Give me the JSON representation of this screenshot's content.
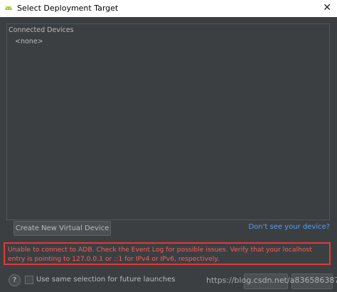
{
  "window": {
    "title": "Select Deployment Target",
    "close_glyph": "✕"
  },
  "devices": {
    "header": "Connected Devices",
    "empty_item": "<none>"
  },
  "actions": {
    "create_virtual_device": "Create New Virtual Device",
    "dont_see_device": "Don't see your device?"
  },
  "error": {
    "message": "Unable to connect to ADB. Check the Event Log for possible issues. Verify that your localhost entry is pointing to 127.0.0.1 or ::1 for IPv4 or IPv6, respectively."
  },
  "footer": {
    "help_glyph": "?",
    "checkbox_label": "Use same selection for future launches",
    "checkbox_checked": false
  },
  "watermark": "https://blog.csdn.net/a836586387",
  "colors": {
    "error": "#ff5a5a",
    "link": "#589df6",
    "android": "#a4c639"
  }
}
